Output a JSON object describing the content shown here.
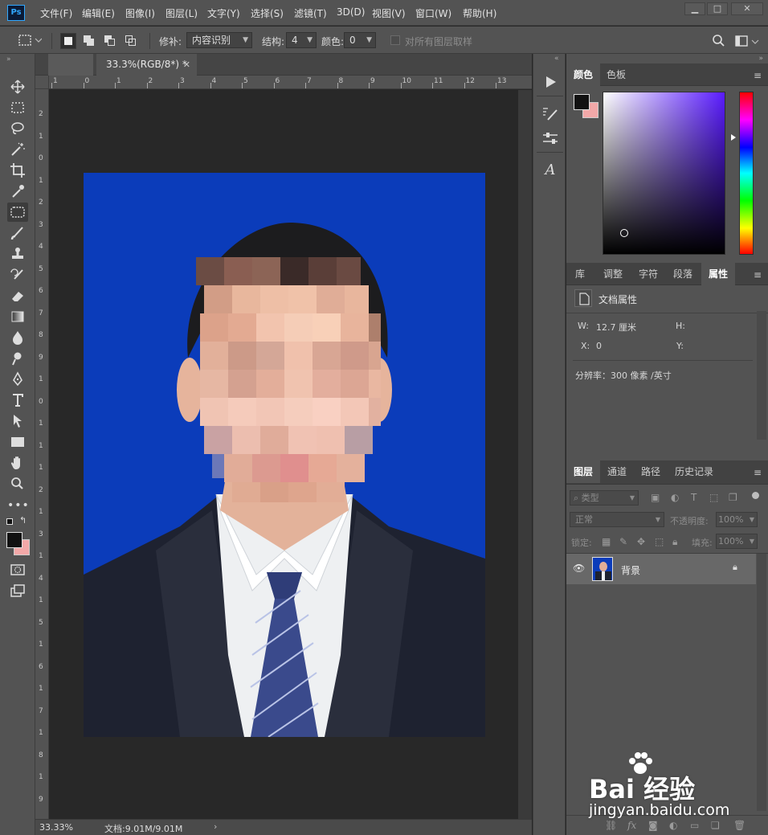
{
  "app": {
    "logo": "Ps"
  },
  "menu": [
    "文件(F)",
    "编辑(E)",
    "图像(I)",
    "图层(L)",
    "文字(Y)",
    "选择(S)",
    "滤镜(T)",
    "3D(D)",
    "视图(V)",
    "窗口(W)",
    "帮助(H)"
  ],
  "window_controls": {
    "minimize": "▁",
    "restore": "□",
    "close": "✕"
  },
  "options": {
    "patch_label": "修补:",
    "patch_value": "内容识别",
    "structure_label": "结构:",
    "structure_value": "4",
    "color_label": "颜色:",
    "color_value": "0",
    "sample_all_layers": "对所有图层取样"
  },
  "document": {
    "tab_title": "33.3%(RGB/8*) *",
    "zoom": "33.33%",
    "doc_size": "文档:9.01M/9.01M",
    "background_color": "#0b3cba"
  },
  "ruler": {
    "horizontal": [
      "1",
      "0",
      "1",
      "2",
      "3",
      "4",
      "5",
      "6",
      "7",
      "8",
      "9",
      "10",
      "11",
      "12",
      "13"
    ],
    "vertical": [
      "2",
      "1",
      "0",
      "1",
      "2",
      "3",
      "4",
      "5",
      "6",
      "7",
      "8",
      "9",
      "1",
      "0",
      "1",
      "1",
      "1",
      "2",
      "1",
      "3",
      "1",
      "4",
      "1",
      "5",
      "1",
      "6",
      "1",
      "7",
      "1",
      "8",
      "1",
      "9"
    ]
  },
  "tools": [
    "move-icon",
    "rect-marquee-icon",
    "lasso-icon",
    "magic-wand-icon",
    "crop-icon",
    "eyedropper-icon",
    "patch-icon",
    "brush-icon",
    "stamp-icon",
    "history-brush-icon",
    "eraser-icon",
    "gradient-icon",
    "blur-icon",
    "dodge-icon",
    "pen-icon",
    "type-icon",
    "path-select-icon",
    "shape-icon",
    "hand-icon",
    "zoom-icon",
    "more-icon"
  ],
  "color_panel": {
    "tabs": [
      "颜色",
      "色板"
    ],
    "active_tab": "颜色",
    "foreground": "#111111",
    "background": "#f2a8a8"
  },
  "properties_panel": {
    "tabs": [
      "库",
      "调整",
      "字符",
      "段落",
      "属性"
    ],
    "active_tab": "属性",
    "section_title": "文档属性",
    "w_label": "W:",
    "w_value": "12.7 厘米",
    "h_label": "H:",
    "x_label": "X:",
    "x_value": "0",
    "y_label": "Y:",
    "resolution": "分辨率：300 像素 /英寸"
  },
  "layers_panel": {
    "tabs": [
      "图层",
      "通道",
      "路径",
      "历史记录"
    ],
    "active_tab": "图层",
    "filter_kind": "类型",
    "blend_mode": "正常",
    "opacity_label": "不透明度:",
    "opacity_value": "100%",
    "lock_label": "锁定:",
    "fill_label": "填充:",
    "fill_value": "100%",
    "layers": [
      {
        "name": "背景",
        "visible": true,
        "locked": true
      }
    ]
  },
  "watermark": {
    "brand": "Bai 经验",
    "url": "jingyan.baidu.com"
  }
}
